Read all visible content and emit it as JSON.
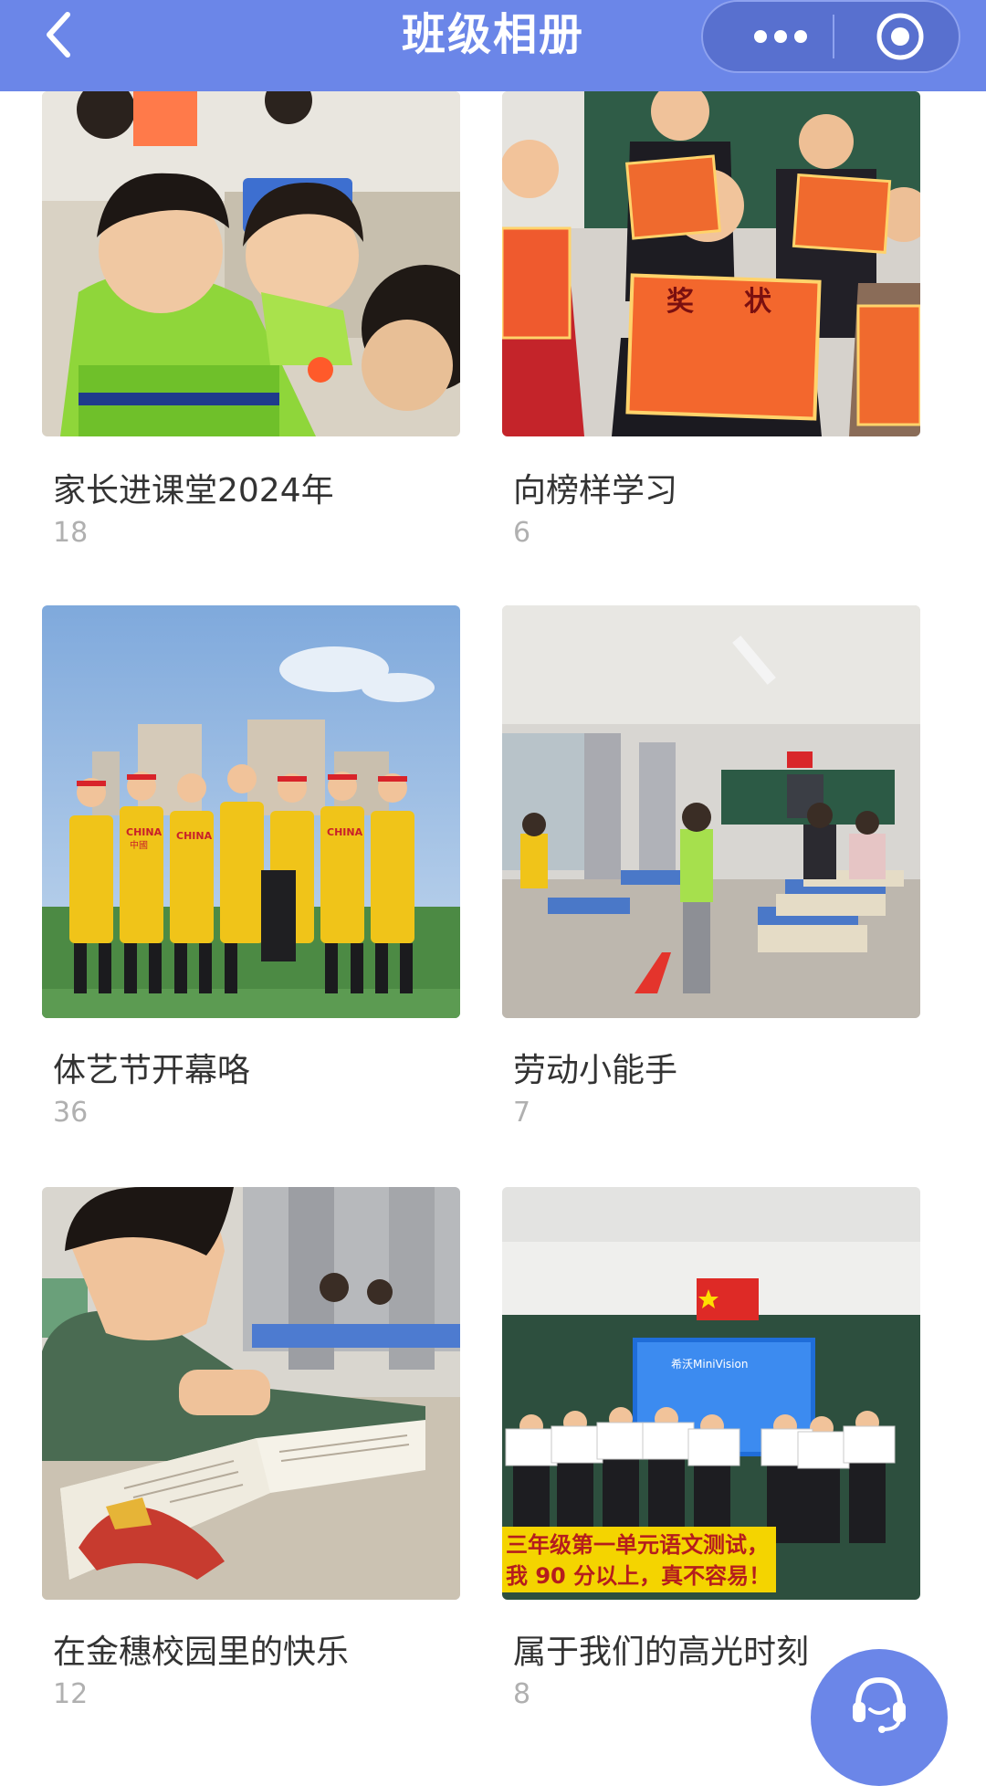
{
  "header": {
    "title": "班级相册",
    "back_icon": "chevron-left-icon",
    "more_icon": "more-dots-icon",
    "target_icon": "target-circle-icon",
    "color": "#6b86e8"
  },
  "albums": [
    {
      "name": "家长进课堂2024年",
      "count": "18"
    },
    {
      "name": "向榜样学习",
      "count": "6"
    },
    {
      "name": "体艺节开幕咯",
      "count": "36"
    },
    {
      "name": "劳动小能手",
      "count": "7"
    },
    {
      "name": "在金穗校园里的快乐",
      "count": "12"
    },
    {
      "name": "属于我们的高光时刻",
      "count": "8"
    }
  ],
  "photo_captions": {
    "certificate_word_1": "奖",
    "certificate_word_2": "状",
    "banner_line_1": "三年级第一单元语文测试，",
    "banner_line_2": "我 90 分以上，真不容易！",
    "jersey_text": "CHINA",
    "jersey_sub": "中國",
    "screen_text": "希沃MiniVision"
  },
  "chat_button": {
    "icon": "headset-icon"
  }
}
